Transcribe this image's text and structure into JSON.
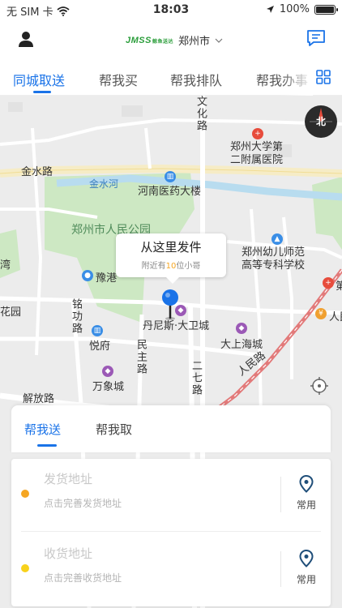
{
  "status_bar": {
    "carrier": "无 SIM 卡",
    "time": "18:03",
    "battery": "100%"
  },
  "header": {
    "logo_text": "JMSS",
    "logo_sub": "鲸鱼送达",
    "city": "郑州市"
  },
  "tabs": [
    {
      "label": "同城取送",
      "active": true
    },
    {
      "label": "帮我买",
      "active": false
    },
    {
      "label": "帮我排队",
      "active": false
    },
    {
      "label": "帮我办事",
      "active": false
    }
  ],
  "map": {
    "labels": {
      "wenhua_road": "文化路",
      "hospital": "郑州大学第二附属医院",
      "jinshui_road": "金水路",
      "jinshui_river": "金水河",
      "pharma_building": "河南医药大楼",
      "park": "郑州市人民公园",
      "teachers_college": "郑州幼儿师范高等专科学校",
      "yugang": "豫港",
      "minggong_road": "铭功路",
      "yuefu": "悦府",
      "minzhu_road": "民主路",
      "danisi": "丹尼斯·大卫城",
      "dashang": "大上海城",
      "erqi_road": "二七路",
      "wanxiang": "万象城",
      "jiefang_road": "解放路",
      "renmin_road": "人民路",
      "ren_edge": "人民",
      "di_edge": "第",
      "yuan_edge": "花园",
      "wan_edge": "湾"
    },
    "compass": "北",
    "callout": {
      "title": "从这里发件",
      "nearby_prefix": "附近有",
      "nearby_count": "10",
      "nearby_suffix": "位小哥"
    }
  },
  "mode_tabs": [
    {
      "label": "帮我送",
      "active": true
    },
    {
      "label": "帮我取",
      "active": false
    }
  ],
  "addresses": [
    {
      "title": "发货地址",
      "hint": "点击完善发货地址",
      "dot_color": "#f5a623",
      "common_label": "常用"
    },
    {
      "title": "收货地址",
      "hint": "点击完善收货地址",
      "dot_color": "#f8d21c",
      "common_label": "常用"
    }
  ],
  "colors": {
    "accent": "#1a73e8",
    "park_green": "#cde8c3",
    "river_blue": "#b8dcef"
  }
}
